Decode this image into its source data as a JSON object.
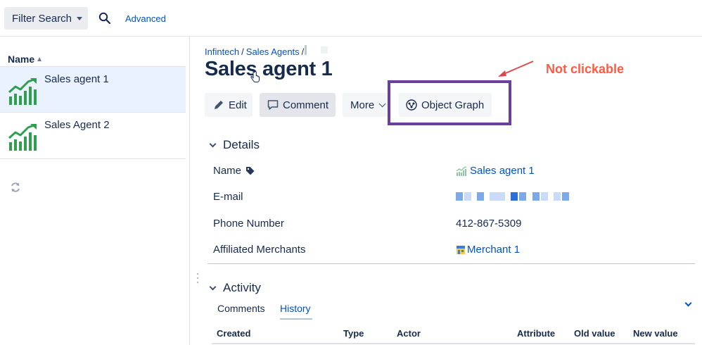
{
  "toolbar": {
    "filter_label": "Filter Search",
    "advanced_label": "Advanced"
  },
  "sidebar": {
    "column_header": "Name",
    "sort_indicator": "up-arrow",
    "items": [
      {
        "label": "Sales agent 1",
        "selected": true
      },
      {
        "label": "Sales Agent 2",
        "selected": false
      }
    ]
  },
  "breadcrumb": {
    "items": [
      "Infintech",
      "Sales Agents"
    ],
    "separator": "/"
  },
  "page": {
    "title": "Sales agent 1"
  },
  "actions": {
    "edit": "Edit",
    "comment": "Comment",
    "more": "More",
    "object_graph": "Object Graph"
  },
  "annotation": {
    "text": "Not clickable",
    "color": "#ff5a44",
    "box_color": "#6b3fa0"
  },
  "details": {
    "header": "Details",
    "fields": [
      {
        "label": "Name",
        "value": "Sales agent 1"
      },
      {
        "label": "E-mail",
        "value": ""
      },
      {
        "label": "Phone Number",
        "value": "412-867-5309"
      },
      {
        "label": "Affiliated Merchants",
        "value": "Merchant 1"
      }
    ]
  },
  "activity": {
    "header": "Activity",
    "tabs": [
      {
        "label": "Comments",
        "active": false
      },
      {
        "label": "History",
        "active": true
      }
    ],
    "columns": [
      "Created",
      "Type",
      "Actor",
      "Attribute",
      "Old value",
      "New value"
    ]
  },
  "colors": {
    "link": "#0052cc",
    "text": "#172b4d",
    "selected_row": "#e9f2fe",
    "icon_green": "#2e9e4f"
  }
}
